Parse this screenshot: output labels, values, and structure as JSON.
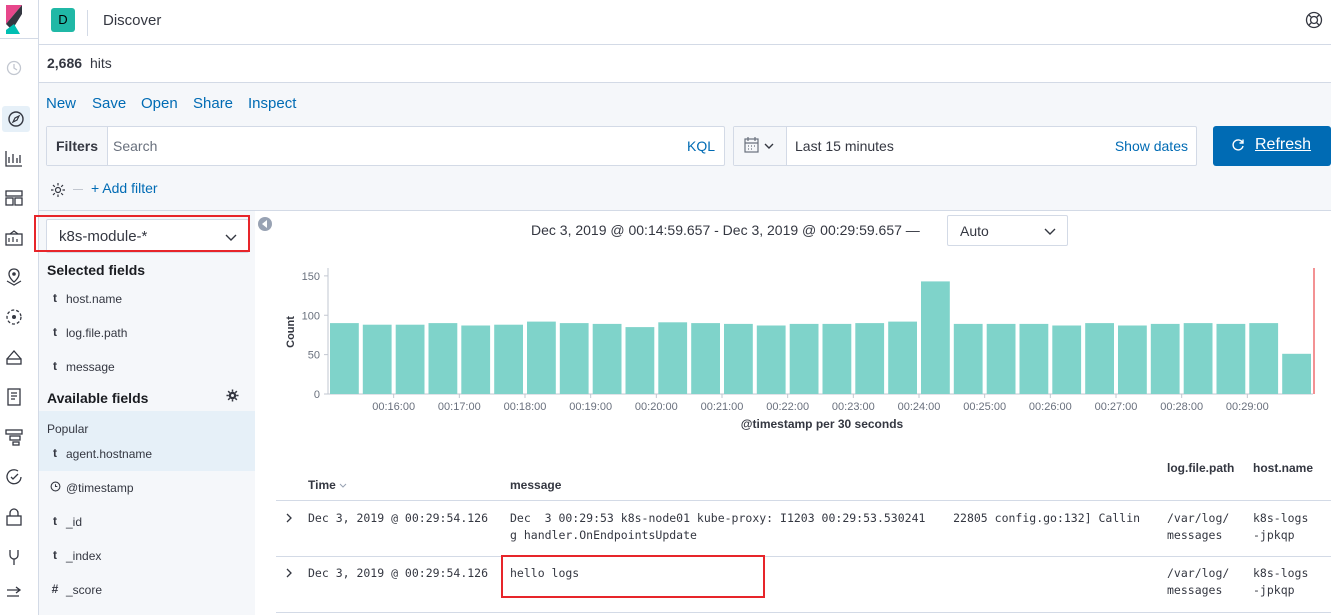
{
  "header": {
    "space_initial": "D",
    "app_title": "Discover"
  },
  "nav": {
    "items": [
      "clock-icon",
      "compass-icon",
      "visualize-icon",
      "dashboard-icon",
      "canvas-icon",
      "maps-icon",
      "ml-icon",
      "infrastructure-icon",
      "logs-icon",
      "apm-icon",
      "uptime-icon",
      "siem-icon",
      "dev-tools-icon",
      "stack-management-icon",
      "collapse-icon"
    ]
  },
  "hits": {
    "count": "2,686",
    "label": "hits"
  },
  "top_menu": {
    "new": "New",
    "save": "Save",
    "open": "Open",
    "share": "Share",
    "inspect": "Inspect"
  },
  "query_bar": {
    "filters_label": "Filters",
    "search_placeholder": "Search",
    "language": "KQL",
    "date_range": "Last 15 minutes",
    "show_dates": "Show dates",
    "refresh": "Refresh",
    "add_filter": "+ Add filter"
  },
  "sidebar": {
    "index_pattern": "k8s-module-*",
    "selected_title": "Selected fields",
    "selected_fields": [
      {
        "type": "t",
        "name": "host.name"
      },
      {
        "type": "t",
        "name": "log.file.path"
      },
      {
        "type": "t",
        "name": "message"
      }
    ],
    "available_title": "Available fields",
    "popular_label": "Popular",
    "available_fields": [
      {
        "type": "t",
        "name": "agent.hostname"
      },
      {
        "type": "clock",
        "name": "@timestamp"
      },
      {
        "type": "t",
        "name": "_id"
      },
      {
        "type": "t",
        "name": "_index"
      },
      {
        "type": "#",
        "name": "_score"
      }
    ]
  },
  "chart_header": {
    "range": "Dec 3, 2019 @ 00:14:59.657 - Dec 3, 2019 @ 00:29:59.657 —",
    "interval": "Auto"
  },
  "chart_data": {
    "type": "bar",
    "ylabel": "Count",
    "xlabel": "@timestamp per 30 seconds",
    "ylim": [
      0,
      160
    ],
    "yticks": [
      0,
      50,
      100,
      150
    ],
    "xticks": [
      "00:16:00",
      "00:17:00",
      "00:18:00",
      "00:19:00",
      "00:20:00",
      "00:21:00",
      "00:22:00",
      "00:23:00",
      "00:24:00",
      "00:25:00",
      "00:26:00",
      "00:27:00",
      "00:28:00",
      "00:29:00"
    ],
    "values": [
      90,
      88,
      88,
      90,
      87,
      88,
      92,
      90,
      89,
      85,
      91,
      90,
      89,
      87,
      89,
      89,
      90,
      92,
      143,
      89,
      89,
      89,
      87,
      90,
      87,
      89,
      90,
      89,
      90,
      51
    ],
    "bar_color": "#7fd3ca"
  },
  "table": {
    "headers": {
      "time": "Time",
      "message": "message",
      "path": "log.file.path",
      "host": "host.name"
    },
    "rows": [
      {
        "time": "Dec 3, 2019 @ 00:29:54.126",
        "message_l1": "Dec  3 00:29:53 k8s-node01 kube-proxy: I1203 00:29:53.530241    22805 config.go:132] Callin",
        "message_l2": "g handler.OnEndpointsUpdate",
        "path_l1": "/var/log/",
        "path_l2": "messages",
        "host_l1": "k8s-logs",
        "host_l2": "-jpkqp"
      },
      {
        "time": "Dec 3, 2019 @ 00:29:54.126",
        "message_l1": "hello logs",
        "message_l2": "",
        "path_l1": "/var/log/",
        "path_l2": "messages",
        "host_l1": "k8s-logs",
        "host_l2": "-jpkqp"
      }
    ]
  },
  "colors": {
    "accent": "#006bb4",
    "highlight": "#e7252a",
    "bar": "#7fd3ca"
  }
}
